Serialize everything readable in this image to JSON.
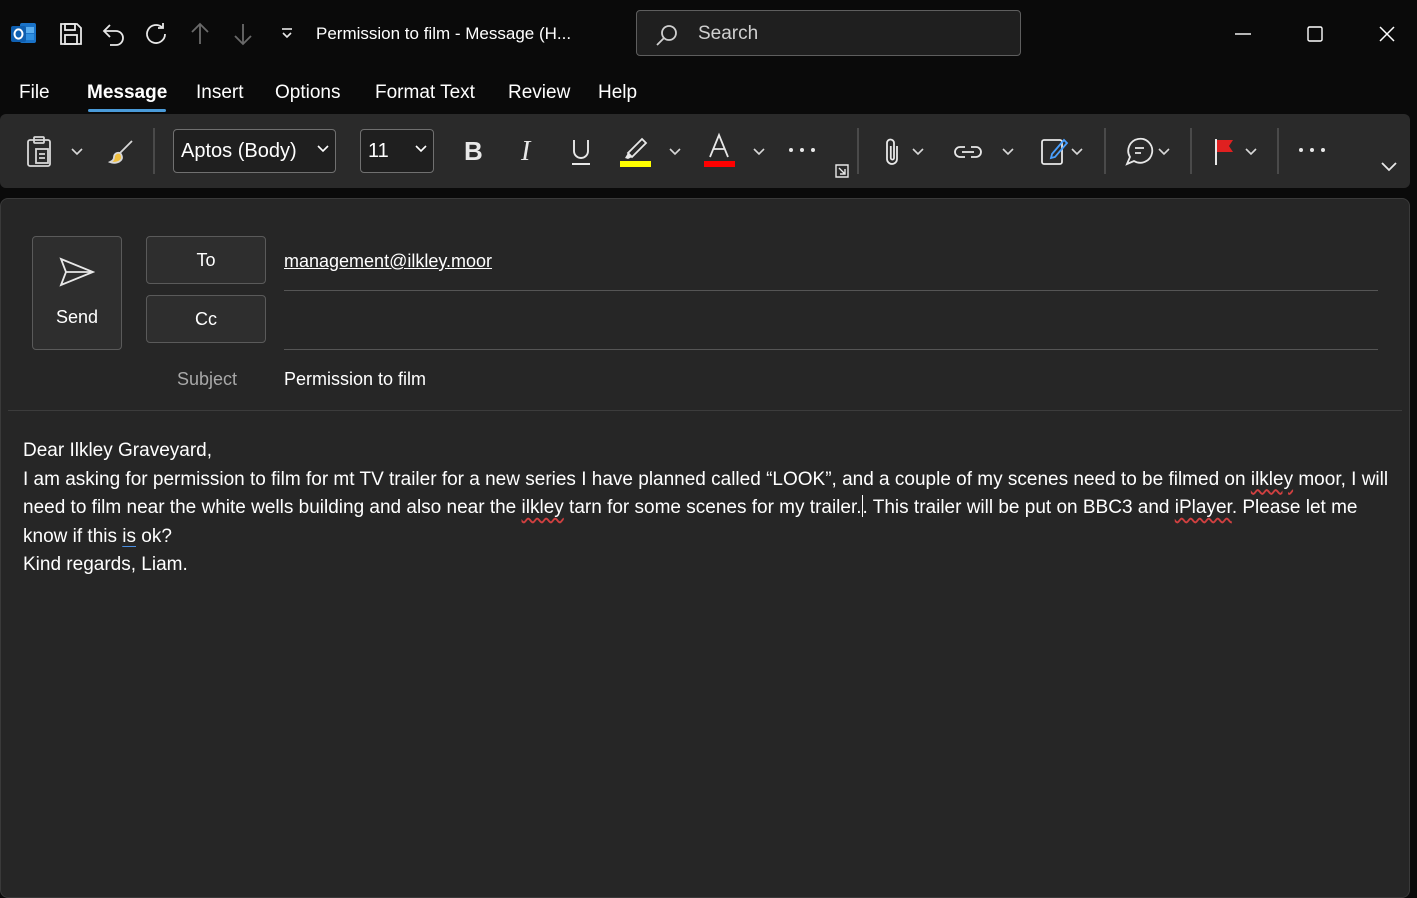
{
  "window": {
    "title": "Permission to film  -  Message (H...",
    "search_placeholder": "Search"
  },
  "tabs": [
    {
      "label": "File"
    },
    {
      "label": "Message",
      "active": true
    },
    {
      "label": "Insert"
    },
    {
      "label": "Options"
    },
    {
      "label": "Format Text"
    },
    {
      "label": "Review"
    },
    {
      "label": "Help"
    }
  ],
  "ribbon": {
    "font_name": "Aptos (Body)",
    "font_size": "11",
    "highlight_color": "#ffff00",
    "font_color": "#ff0000",
    "flag_color": "#e02020"
  },
  "compose": {
    "send_label": "Send",
    "to_label": "To",
    "cc_label": "Cc",
    "subject_label": "Subject",
    "to_value": "management@ilkley.moor",
    "cc_value": "",
    "subject_value": "Permission to film"
  },
  "body": {
    "greeting": "Dear Ilkley Graveyard,",
    "p1_a": "I am asking for permission to film for mt TV trailer for a new series I have planned called “LOOK”, and a couple of my scenes need to be filmed on ",
    "p1_w1": "ilkley",
    "p1_b": " moor, I will need to film near the white wells building and also near the ",
    "p1_w2": "ilkley",
    "p1_c": " tarn for some scenes for my trailer.",
    "p1_d": ". This trailer will be put on BBC3 and ",
    "p1_w3": "iPlayer",
    "p1_e": ". Please let me know if this ",
    "p1_w4": "is",
    "p1_f": " ok?",
    "closing": "Kind regards, Liam."
  }
}
